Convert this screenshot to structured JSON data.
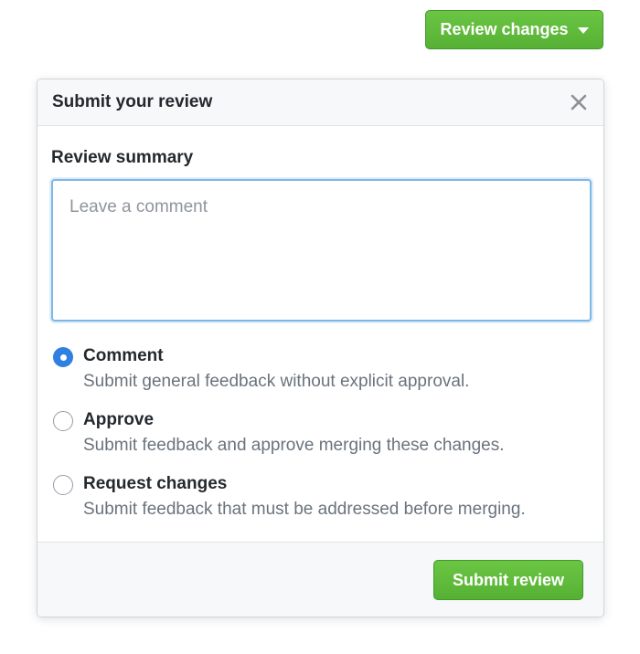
{
  "toolbar": {
    "review_changes_label": "Review changes",
    "review_changes_icon": "caret-down-icon"
  },
  "popover": {
    "title": "Submit your review",
    "close_icon": "close-icon",
    "summary_label": "Review summary",
    "comment_placeholder": "Leave a comment",
    "comment_value": "",
    "options": [
      {
        "id": "comment",
        "title": "Comment",
        "description": "Submit general feedback without explicit approval.",
        "checked": true
      },
      {
        "id": "approve",
        "title": "Approve",
        "description": "Submit feedback and approve merging these changes.",
        "checked": false
      },
      {
        "id": "request-changes",
        "title": "Request changes",
        "description": "Submit feedback that must be addressed before merging.",
        "checked": false
      }
    ],
    "submit_label": "Submit review"
  },
  "colors": {
    "primary_green": "#5cb539",
    "radio_selected_blue": "#2f80e0",
    "textarea_focus_border": "#7cb8e6",
    "muted_text": "#6a737d"
  }
}
